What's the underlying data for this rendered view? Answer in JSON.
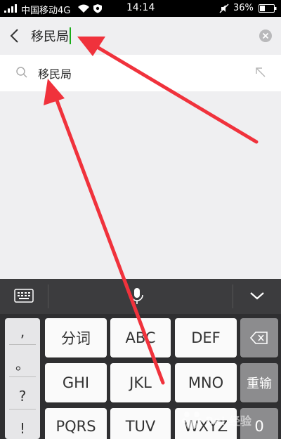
{
  "status_bar": {
    "carrier": "中国移动4G",
    "time": "14:14",
    "battery": "36%"
  },
  "search": {
    "query": "移民局"
  },
  "suggestions": [
    {
      "text": "移民局"
    }
  ],
  "keyboard": {
    "punctuation": [
      ",",
      "。",
      "?",
      "!"
    ],
    "rows": [
      [
        "分词",
        "ABC",
        "DEF"
      ],
      [
        "GHI",
        "JKL",
        "MNO"
      ],
      [
        "PQRS",
        "TUV",
        "WXYZ"
      ]
    ],
    "backspace_icon": "backspace-icon",
    "reenter_label": "重输",
    "zero_label": "0"
  },
  "watermark": {
    "text": "Bai 经验"
  },
  "colors": {
    "caret": "#1aad19",
    "arrow": "#f0323c"
  }
}
